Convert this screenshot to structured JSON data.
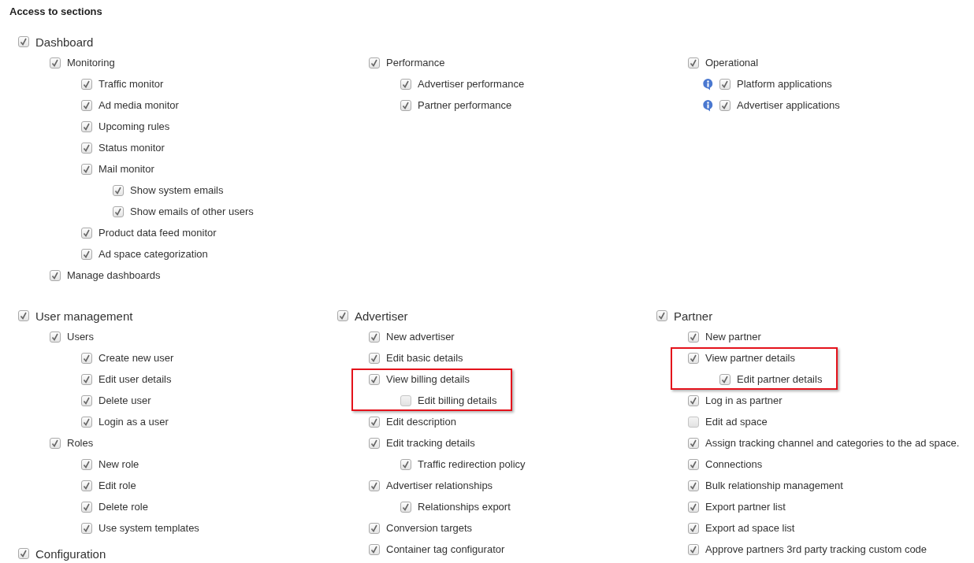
{
  "heading": "Access to sections",
  "dashboard": {
    "label": "Dashboard",
    "checked": true,
    "columns": [
      [
        {
          "label": "Monitoring",
          "checked": true,
          "children": [
            {
              "label": "Traffic monitor",
              "checked": true
            },
            {
              "label": "Ad media monitor",
              "checked": true
            },
            {
              "label": "Upcoming rules",
              "checked": true
            },
            {
              "label": "Status monitor",
              "checked": true
            },
            {
              "label": "Mail monitor",
              "checked": true,
              "children": [
                {
                  "label": "Show system emails",
                  "checked": true
                },
                {
                  "label": "Show emails of other users",
                  "checked": true
                }
              ]
            },
            {
              "label": "Product data feed monitor",
              "checked": true
            },
            {
              "label": "Ad space categorization",
              "checked": true
            }
          ]
        },
        {
          "label": "Manage dashboards",
          "checked": true
        }
      ],
      [
        {
          "label": "Performance",
          "checked": true,
          "children": [
            {
              "label": "Advertiser performance",
              "checked": true
            },
            {
              "label": "Partner performance",
              "checked": true
            }
          ]
        }
      ],
      [
        {
          "label": "Operational",
          "checked": true,
          "children": [
            {
              "label": "Platform applications",
              "checked": true,
              "info": true
            },
            {
              "label": "Advertiser applications",
              "checked": true,
              "info": true
            }
          ]
        }
      ]
    ]
  },
  "sections": [
    [
      {
        "label": "User management",
        "checked": true,
        "children": [
          {
            "label": "Users",
            "checked": true,
            "children": [
              {
                "label": "Create new user",
                "checked": true
              },
              {
                "label": "Edit user details",
                "checked": true
              },
              {
                "label": "Delete user",
                "checked": true
              },
              {
                "label": "Login as a user",
                "checked": true
              }
            ]
          },
          {
            "label": "Roles",
            "checked": true,
            "children": [
              {
                "label": "New role",
                "checked": true
              },
              {
                "label": "Edit role",
                "checked": true
              },
              {
                "label": "Delete role",
                "checked": true
              },
              {
                "label": "Use system templates",
                "checked": true
              }
            ]
          }
        ]
      },
      {
        "label": "Configuration",
        "checked": true
      }
    ],
    [
      {
        "label": "Advertiser",
        "checked": true,
        "children": [
          {
            "label": "New advertiser",
            "checked": true
          },
          {
            "label": "Edit basic details",
            "checked": true
          },
          {
            "label": "View billing details",
            "checked": true,
            "highlighted": true,
            "children": [
              {
                "label": "Edit billing details",
                "checked": false
              }
            ]
          },
          {
            "label": "Edit description",
            "checked": true
          },
          {
            "label": "Edit tracking details",
            "checked": true,
            "children": [
              {
                "label": "Traffic redirection policy",
                "checked": true
              }
            ]
          },
          {
            "label": "Advertiser relationships",
            "checked": true,
            "children": [
              {
                "label": "Relationships export",
                "checked": true
              }
            ]
          },
          {
            "label": "Conversion targets",
            "checked": true
          },
          {
            "label": "Container tag configurator",
            "checked": true
          }
        ]
      }
    ],
    [
      {
        "label": "Partner",
        "checked": true,
        "children": [
          {
            "label": "New partner",
            "checked": true
          },
          {
            "label": "View partner details",
            "checked": true,
            "highlighted": true,
            "children": [
              {
                "label": "Edit partner details",
                "checked": true
              }
            ]
          },
          {
            "label": "Log in as partner",
            "checked": true
          },
          {
            "label": "Edit ad space",
            "checked": false
          },
          {
            "label": "Assign tracking channel and categories to the ad space.",
            "checked": true
          },
          {
            "label": "Connections",
            "checked": true
          },
          {
            "label": "Bulk relationship management",
            "checked": true
          },
          {
            "label": "Export partner list",
            "checked": true
          },
          {
            "label": "Export ad space list",
            "checked": true
          },
          {
            "label": "Approve partners 3rd party tracking custom code",
            "checked": true
          }
        ]
      }
    ]
  ]
}
